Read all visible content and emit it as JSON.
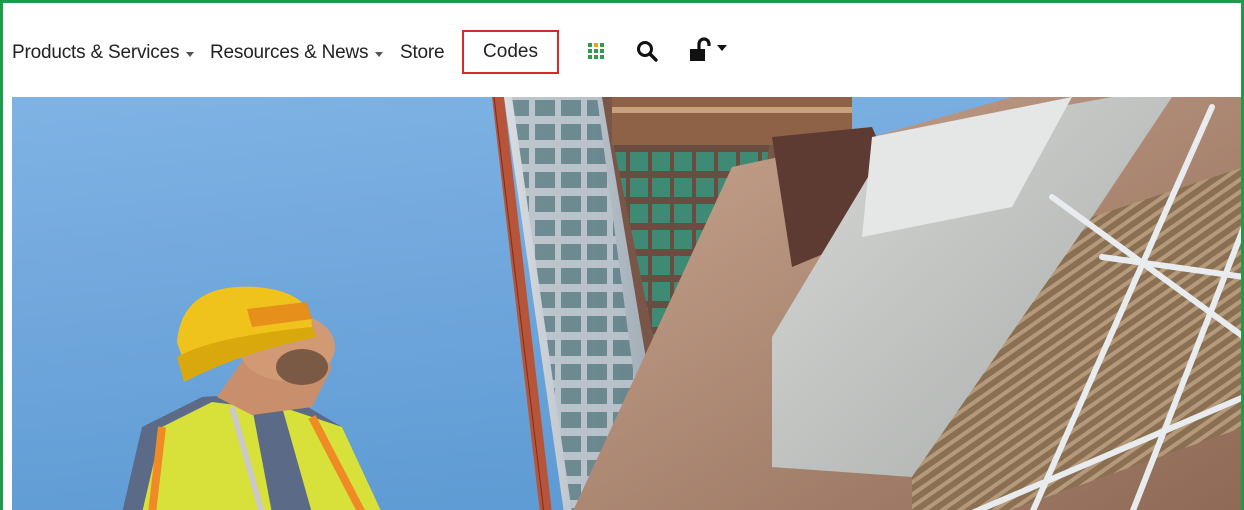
{
  "nav": {
    "products_label": "Products & Services",
    "resources_label": "Resources & News",
    "store_label": "Store",
    "codes_label": "Codes"
  },
  "icons": {
    "apps": "grid-icon",
    "search": "search-icon",
    "account": "unlock-icon"
  },
  "colors": {
    "frame_border": "#1e9a4a",
    "highlight_box": "#d42a2a",
    "nav_text": "#222222",
    "grid_icon_green": "#2e9b4f",
    "sky": "#6aa6dc"
  },
  "hero": {
    "description_icon": "construction-worker-image"
  }
}
